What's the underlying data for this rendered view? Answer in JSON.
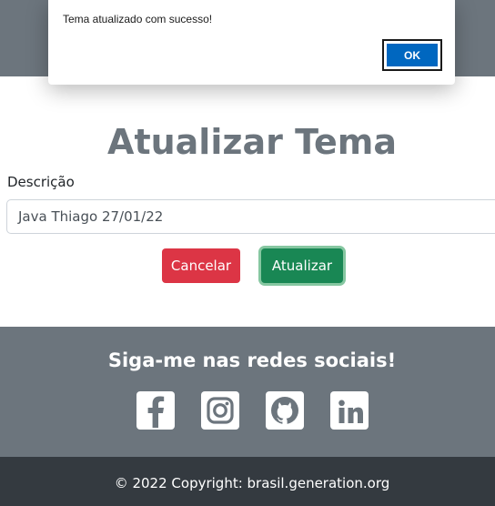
{
  "alert": {
    "message": "Tema atualizado com sucesso!",
    "ok_label": "OK"
  },
  "form": {
    "title": "Atualizar Tema",
    "description_label": "Descrição",
    "description_value": "Java Thiago 27/01/22",
    "cancel_label": "Cancelar",
    "submit_label": "Atualizar"
  },
  "footer": {
    "social_title": "Siga-me nas redes sociais!",
    "social_links": [
      "facebook",
      "instagram",
      "github",
      "linkedin"
    ],
    "copyright": "© 2022 Copyright: brasil.generation.org"
  },
  "colors": {
    "header_bg": "#6c757d",
    "footer_dark": "#343a40",
    "danger": "#dc3545",
    "success": "#198754",
    "dialog_button": "#0067c0"
  }
}
